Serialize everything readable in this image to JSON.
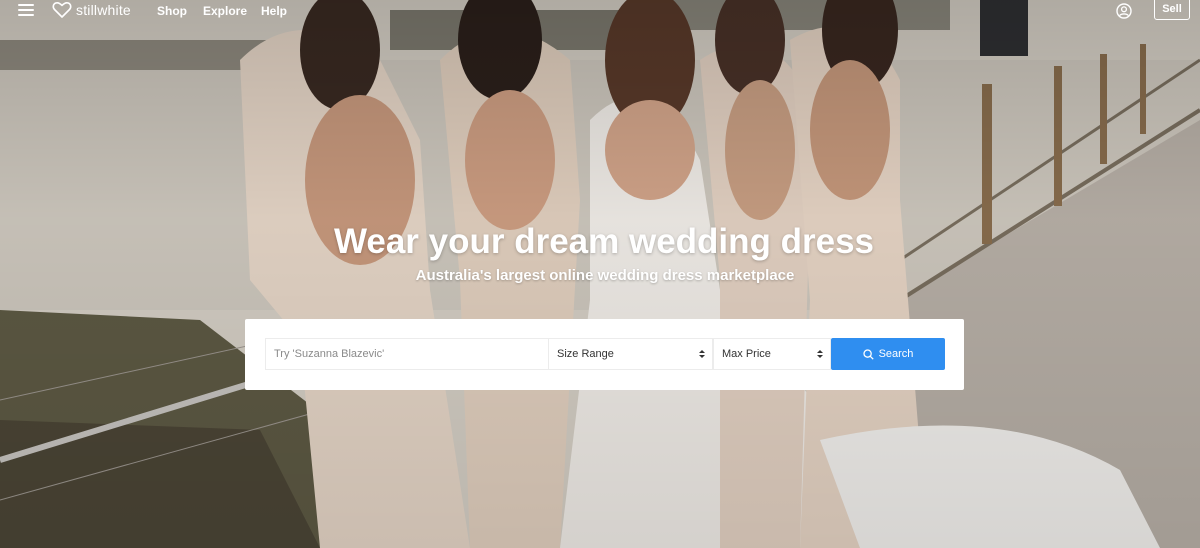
{
  "brand": {
    "name": "stillwhite"
  },
  "nav": {
    "links": [
      "Shop",
      "Explore",
      "Help"
    ],
    "sell_label": "Sell"
  },
  "hero": {
    "headline": "Wear your dream wedding dress",
    "subheadline": "Australia's largest online wedding dress marketplace"
  },
  "search": {
    "placeholder": "Try 'Suzanna Blazevic'",
    "size_range_label": "Size Range",
    "max_price_label": "Max Price",
    "button_label": "Search"
  },
  "colors": {
    "accent": "#2f8ef0",
    "text_light": "#ffffff"
  },
  "icons": [
    "menu-icon",
    "heart-logo-icon",
    "account-icon",
    "search-icon",
    "select-arrows-icon"
  ]
}
